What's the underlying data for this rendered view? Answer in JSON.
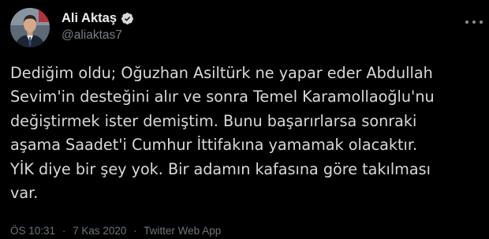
{
  "author": {
    "display_name": "Ali Aktaş",
    "handle": "@aliaktas7",
    "verified": true,
    "avatar_icon": "profile-photo"
  },
  "tweet": {
    "lines": [
      "Dediğim oldu; Oğuzhan Asiltürk ne yapar eder Abdullah",
      "Sevim'in desteğini alır ve sonra Temel Karamollaoğlu'nu",
      "değiştirmek ister demiştim. Bunu başarırlarsa sonraki",
      "aşama Saadet'i Cumhur İttifakına yamamak olacaktır.",
      "YİK diye bir şey yok. Bir adamın kafasına göre takılması",
      "var."
    ]
  },
  "meta": {
    "time": "ÖS 10:31",
    "separator": "·",
    "date": "7 Kas 2020",
    "source": "Twitter Web App"
  },
  "colors": {
    "background": "#000000",
    "text": "#d9d9d9",
    "secondary": "#6e7378",
    "verified_badge": "#d9d9d9"
  },
  "icons": {
    "more": "more-horizontal-icon",
    "verified": "verified-badge-icon"
  }
}
